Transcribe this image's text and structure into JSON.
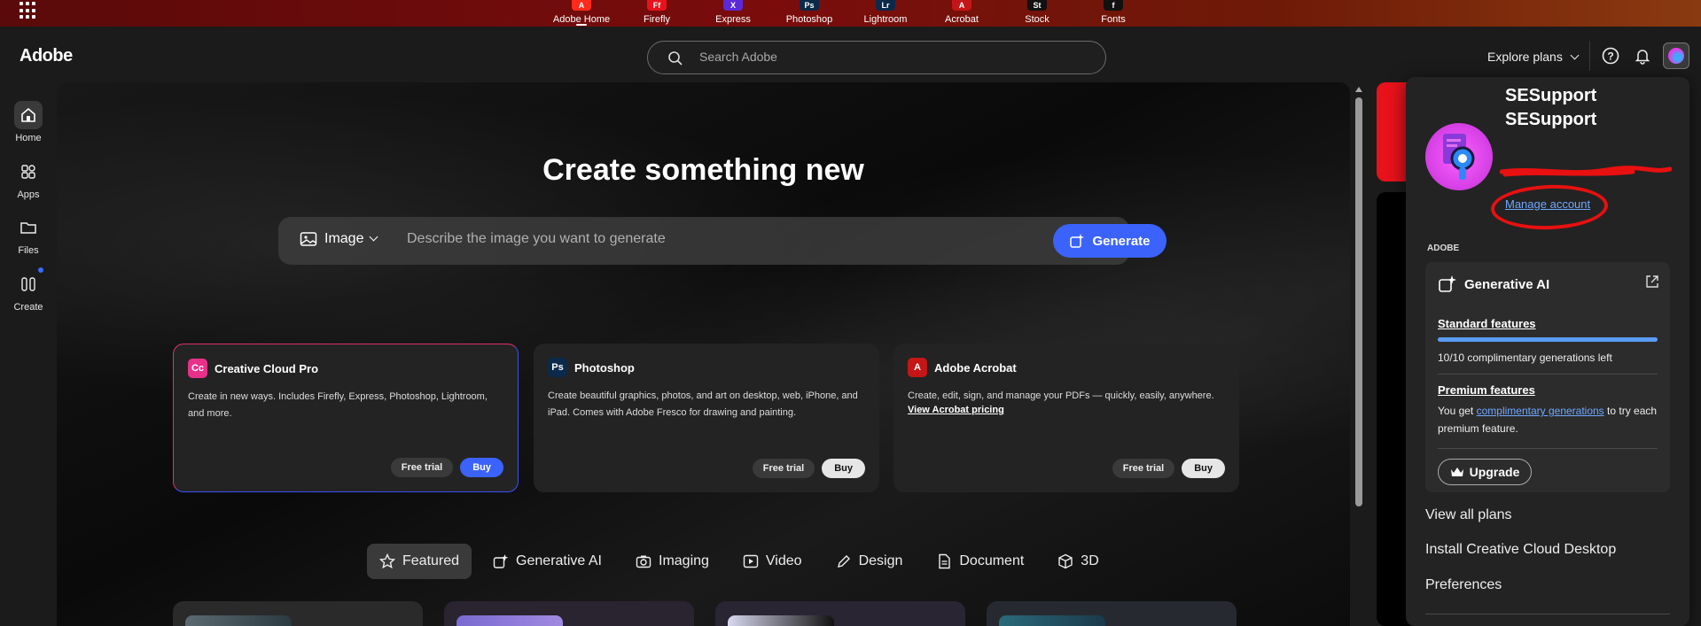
{
  "app_bar": {
    "apps": [
      {
        "label": "Adobe Home",
        "abbr": "A",
        "color": "#ff2a1a"
      },
      {
        "label": "Firefly",
        "abbr": "Ff",
        "color": "#e8121b"
      },
      {
        "label": "Express",
        "abbr": "X",
        "color": "#5a2ad8"
      },
      {
        "label": "Photoshop",
        "abbr": "Ps",
        "color": "#0b2a4a"
      },
      {
        "label": "Lightroom",
        "abbr": "Lr",
        "color": "#0b2a4a"
      },
      {
        "label": "Acrobat",
        "abbr": "A",
        "color": "#c41616"
      },
      {
        "label": "Stock",
        "abbr": "St",
        "color": "#111111"
      },
      {
        "label": "Fonts",
        "abbr": "f",
        "color": "#111111"
      }
    ]
  },
  "header": {
    "logo": "Adobe",
    "search_placeholder": "Search Adobe",
    "explore_plans": "Explore plans"
  },
  "rail": {
    "items": [
      {
        "label": "Home",
        "icon": "home-icon"
      },
      {
        "label": "Apps",
        "icon": "apps-icon"
      },
      {
        "label": "Files",
        "icon": "folder-icon"
      },
      {
        "label": "Create",
        "icon": "create-icon"
      }
    ]
  },
  "hero": {
    "title": "Create something new",
    "gen_type": "Image",
    "gen_placeholder": "Describe the image you want to generate",
    "gen_button": "Generate"
  },
  "products": [
    {
      "name": "Creative Cloud Pro",
      "abbr": "Cc",
      "color": "#e8308a",
      "desc": "Create in new ways. Includes Firefly, Express, Photoshop, Lightroom, and more.",
      "link": "",
      "trial": "Free trial",
      "buy": "Buy"
    },
    {
      "name": "Photoshop",
      "abbr": "Ps",
      "color": "#0b2a4a",
      "desc": "Create beautiful graphics, photos, and art on desktop, web, iPhone, and iPad. Comes with Adobe Fresco for drawing and painting.",
      "link": "",
      "trial": "Free trial",
      "buy": "Buy"
    },
    {
      "name": "Adobe Acrobat",
      "abbr": "A",
      "color": "#c41616",
      "desc": "Create, edit, sign, and manage your PDFs — quickly, easily, anywhere.",
      "link": "View Acrobat pricing",
      "trial": "Free trial",
      "buy": "Buy"
    }
  ],
  "categories": [
    {
      "label": "Featured",
      "icon": "star-icon"
    },
    {
      "label": "Generative AI",
      "icon": "generative-ai-icon"
    },
    {
      "label": "Imaging",
      "icon": "camera-icon"
    },
    {
      "label": "Video",
      "icon": "video-icon"
    },
    {
      "label": "Design",
      "icon": "pen-icon"
    },
    {
      "label": "Document",
      "icon": "document-icon"
    },
    {
      "label": "3D",
      "icon": "cube-icon"
    }
  ],
  "account_panel": {
    "name_line1": "SESupport",
    "name_line2": "SESupport",
    "manage_account": "Manage account",
    "section_label": "ADOBE",
    "gen_ai_title": "Generative AI",
    "standard_features": "Standard features",
    "progress": 1.0,
    "generations_left": "10/10 complimentary generations left",
    "premium_features": "Premium features",
    "premium_text_before": "You get",
    "premium_link": "complimentary generations",
    "premium_text_after": "to try each premium feature.",
    "upgrade": "Upgrade",
    "links": [
      "View all plans",
      "Install Creative Cloud Desktop",
      "Preferences"
    ]
  },
  "colors": {
    "accent_blue": "#3b63fb",
    "annotation_red": "#e81010",
    "link_blue": "#6fa8ff"
  }
}
